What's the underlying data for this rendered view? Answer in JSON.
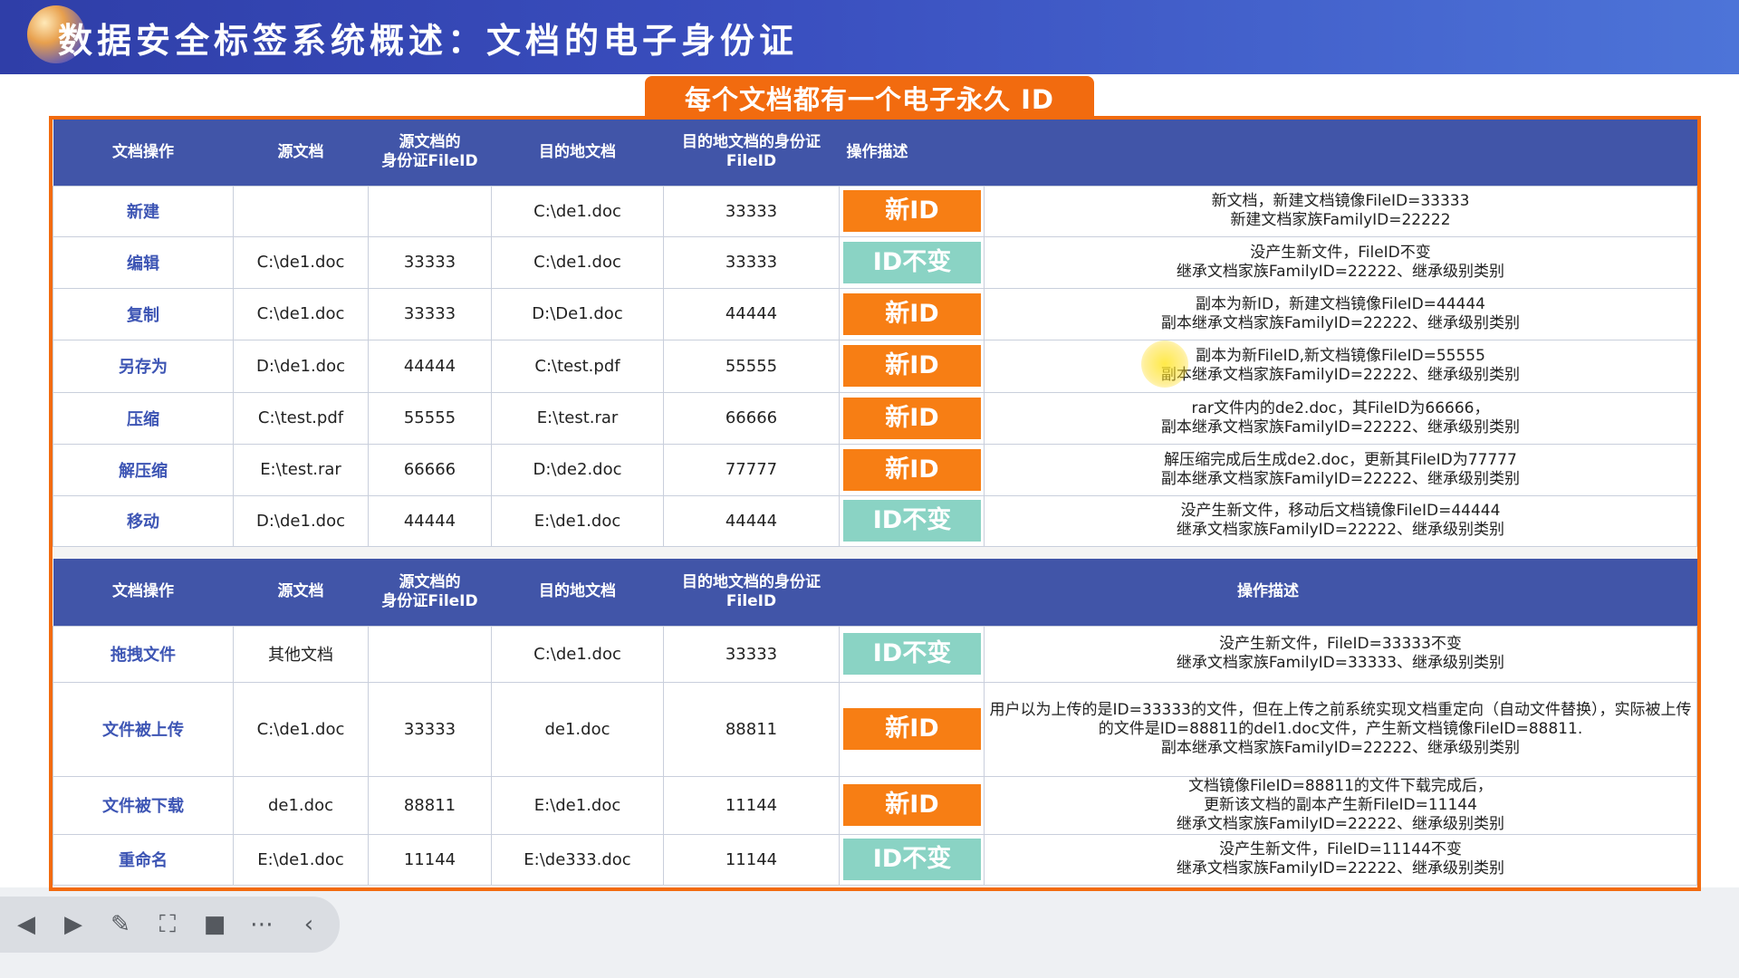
{
  "title": "数据安全标签系统概述：文档的电子身份证",
  "subtitle": "每个文档都有一个电子永久 ID",
  "table1": {
    "headers": [
      "文档操作",
      "源文档",
      "源文档的\n身份证FileID",
      "目的地文档",
      "目的地文档的身份证\nFileID",
      "操作描述"
    ],
    "rows": [
      {
        "op": "新建",
        "src": "",
        "src_id": "",
        "dst": "C:\\de1.doc",
        "dst_id": "33333",
        "badge": "新ID",
        "badge_type": "new",
        "desc": "新文档，新建文档镜像FileID=33333\n新建文档家族FamilyID=22222"
      },
      {
        "op": "编辑",
        "src": "C:\\de1.doc",
        "src_id": "33333",
        "dst": "C:\\de1.doc",
        "dst_id": "33333",
        "badge": "ID不变",
        "badge_type": "same",
        "desc": "没产生新文件，FileID不变\n继承文档家族FamilyID=22222、继承级别类别"
      },
      {
        "op": "复制",
        "src": "C:\\de1.doc",
        "src_id": "33333",
        "dst": "D:\\De1.doc",
        "dst_id": "44444",
        "badge": "新ID",
        "badge_type": "new",
        "desc": "副本为新ID，新建文档镜像FileID=44444\n副本继承文档家族FamilyID=22222、继承级别类别"
      },
      {
        "op": "另存为",
        "src": "D:\\de1.doc",
        "src_id": "44444",
        "dst": "C:\\test.pdf",
        "dst_id": "55555",
        "badge": "新ID",
        "badge_type": "new",
        "desc": "副本为新FileID,新文档镜像FileID=55555\n副本继承文档家族FamilyID=22222、继承级别类别"
      },
      {
        "op": "压缩",
        "src": "C:\\test.pdf",
        "src_id": "55555",
        "dst": "E:\\test.rar",
        "dst_id": "66666",
        "badge": "新ID",
        "badge_type": "new",
        "desc": "rar文件内的de2.doc，其FileID为66666，\n副本继承文档家族FamilyID=22222、继承级别类别"
      },
      {
        "op": "解压缩",
        "src": "E:\\test.rar",
        "src_id": "66666",
        "dst": "D:\\de2.doc",
        "dst_id": "77777",
        "badge": "新ID",
        "badge_type": "new",
        "desc": "解压缩完成后生成de2.doc，更新其FileID为77777\n副本继承文档家族FamilyID=22222、继承级别类别"
      },
      {
        "op": "移动",
        "src": "D:\\de1.doc",
        "src_id": "44444",
        "dst": "E:\\de1.doc",
        "dst_id": "44444",
        "badge": "ID不变",
        "badge_type": "same",
        "desc": "没产生新文件，移动后文档镜像FileID=44444\n继承文档家族FamilyID=22222、继承级别类别"
      }
    ]
  },
  "table2": {
    "headers": [
      "文档操作",
      "源文档",
      "源文档的\n身份证FileID",
      "目的地文档",
      "目的地文档的身份证\nFileID",
      "操作描述"
    ],
    "rows": [
      {
        "op": "拖拽文件",
        "src": "其他文档",
        "src_id": "",
        "dst": "C:\\de1.doc",
        "dst_id": "33333",
        "badge": "ID不变",
        "badge_type": "same",
        "desc": "没产生新文件，FileID=33333不变\n继承文档家族FamilyID=33333、继承级别类别"
      },
      {
        "op": "文件被上传",
        "src": "C:\\de1.doc",
        "src_id": "33333",
        "dst": "de1.doc",
        "dst_id": "88811",
        "badge": "新ID",
        "badge_type": "new",
        "desc": "用户以为上传的是ID=33333的文件，但在上传之前系统实现文档重定向（自动文件替换），实际被上传的文件是ID=88811的del1.doc文件，产生新文档镜像FileID=88811.\n副本继承文档家族FamilyID=22222、继承级别类别"
      },
      {
        "op": "文件被下载",
        "src": "de1.doc",
        "src_id": "88811",
        "dst": "E:\\de1.doc",
        "dst_id": "11144",
        "badge": "新ID",
        "badge_type": "new",
        "desc": "文档镜像FileID=88811的文件下载完成后，\n更新该文档的副本产生新FileID=11144\n继承文档家族FamilyID=22222、继承级别类别"
      },
      {
        "op": "重命名",
        "src": "E:\\de1.doc",
        "src_id": "11144",
        "dst": "E:\\de333.doc",
        "dst_id": "11144",
        "badge": "ID不变",
        "badge_type": "same",
        "desc": "没产生新文件，FileID=11144不变\n继承文档家族FamilyID=22222、继承级别类别"
      }
    ]
  },
  "colors": {
    "title_bar": "#3a4fbf",
    "accent": "#f26b0f",
    "header": "#4155a8",
    "new_badge": "#f77e14",
    "same_badge": "#8ad3c4"
  },
  "toolbar": {
    "icons": [
      "prev-icon",
      "play-icon",
      "pen-icon",
      "screenshot-icon",
      "camera-icon",
      "more-icon",
      "collapse-icon"
    ]
  }
}
